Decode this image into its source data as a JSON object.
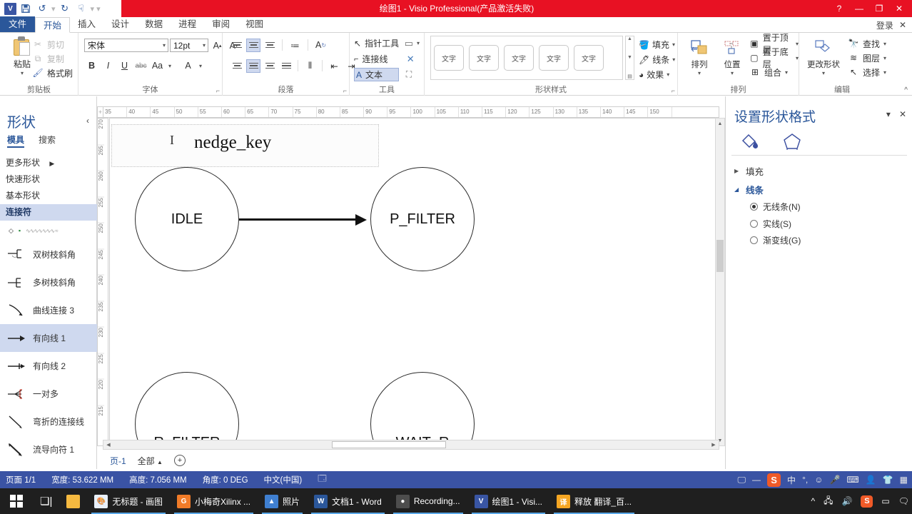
{
  "window": {
    "title": "绘图1 -  Visio Professional(产品激活失败)",
    "logo": "V",
    "quick_access": [
      "save-icon",
      "undo-icon",
      "redo-icon",
      "pointer-icon",
      "more-icon"
    ],
    "help_label": "?",
    "minimize_label": "—",
    "restore_label": "❐",
    "close_label": "✕",
    "signin_label": "登录",
    "signin_close": "✕"
  },
  "ribbon": {
    "file_tab": "文件",
    "tabs": [
      {
        "label": "开始",
        "active": true
      },
      {
        "label": "插入",
        "active": false
      },
      {
        "label": "设计",
        "active": false
      },
      {
        "label": "数据",
        "active": false
      },
      {
        "label": "进程",
        "active": false
      },
      {
        "label": "审阅",
        "active": false
      },
      {
        "label": "视图",
        "active": false
      }
    ],
    "groups": {
      "clipboard": {
        "label": "剪贴板",
        "paste_label": "粘贴",
        "cut_label": "剪切",
        "copy_label": "复制",
        "format_painter_label": "格式刷"
      },
      "font": {
        "label": "字体",
        "font_name": "宋体",
        "font_size": "12pt",
        "grow_label": "A",
        "shrink_label": "A",
        "bold_label": "B",
        "italic_label": "I",
        "underline_label": "U",
        "strike_label": "abc",
        "case_label": "Aa",
        "color_label": "A"
      },
      "paragraph": {
        "label": "段落",
        "bullets_label": "≔",
        "text_dir_label": "A"
      },
      "tools": {
        "label": "工具",
        "pointer_label": "指针工具",
        "connector_label": "连接线",
        "text_label": "文本"
      },
      "shape_styles": {
        "label": "形状样式",
        "thumbnails": [
          "文字",
          "文字",
          "文字",
          "文字",
          "文字"
        ],
        "fill_label": "填充",
        "line_label": "线条",
        "effects_label": "效果"
      },
      "arrange": {
        "label": "排列",
        "arrange_label": "排列",
        "position_label": "位置",
        "bring_front_label": "置于顶层",
        "send_back_label": "置于底层",
        "group_label": "组合"
      },
      "editing": {
        "label": "编辑",
        "change_shape_label": "更改形状",
        "find_label": "查找",
        "layers_label": "图层",
        "select_label": "选择"
      }
    }
  },
  "shapes_panel": {
    "title": "形状",
    "collapse_label": "‹",
    "tabs": [
      {
        "label": "模具",
        "active": true
      },
      {
        "label": "搜索",
        "active": false
      }
    ],
    "categories": [
      {
        "label": "更多形状",
        "active": false,
        "has_arrow": true
      },
      {
        "label": "快速形状",
        "active": false,
        "has_arrow": false
      },
      {
        "label": "基本形状",
        "active": false,
        "has_arrow": false
      },
      {
        "label": "连接符",
        "active": true,
        "has_arrow": false
      }
    ],
    "shapes": [
      {
        "label": "双树枝斜角",
        "active": false
      },
      {
        "label": "多树枝斜角",
        "active": false
      },
      {
        "label": "曲线连接 3",
        "active": false
      },
      {
        "label": "有向线 1",
        "active": true
      },
      {
        "label": "有向线 2",
        "active": false
      },
      {
        "label": "一对多",
        "active": false
      },
      {
        "label": "弯折的连接线",
        "active": false
      },
      {
        "label": "流导向符 1",
        "active": false
      }
    ]
  },
  "canvas": {
    "ruler_h_ticks": [
      "35",
      "40",
      "45",
      "50",
      "55",
      "60",
      "65",
      "70",
      "75",
      "80",
      "85",
      "90",
      "95",
      "100",
      "105",
      "110",
      "115",
      "120",
      "125",
      "130",
      "135",
      "140",
      "145",
      "150"
    ],
    "ruler_v_ticks": [
      "270",
      "265",
      "260",
      "255",
      "250",
      "245",
      "240",
      "235",
      "230",
      "225",
      "220",
      "215"
    ],
    "textbox_value": "nedge_key",
    "nodes": [
      {
        "label": "IDLE"
      },
      {
        "label": "P_FILTER"
      },
      {
        "label": "R_FILTER"
      },
      {
        "label": "WAIT_R"
      }
    ],
    "page_tab": "页-1",
    "all_pages_label": "全部",
    "add_page_label": "+"
  },
  "format_panel": {
    "title": "设置形状格式",
    "collapse_label": "▾",
    "close_label": "✕",
    "icons": [
      "fill-bucket-icon",
      "pentagon-shape-icon"
    ],
    "sections": [
      {
        "label": "填充",
        "expanded": false
      },
      {
        "label": "线条",
        "expanded": true
      }
    ],
    "line_options": [
      {
        "label": "无线条(N)",
        "selected": true
      },
      {
        "label": "实线(S)",
        "selected": false
      },
      {
        "label": "渐变线(G)",
        "selected": false
      }
    ]
  },
  "statusbar": {
    "page_label": "页面 1/1",
    "width_label": "宽度: 53.622 MM",
    "height_label": "高度: 7.056 MM",
    "angle_label": "角度: 0 DEG",
    "language_label": "中文(中国)",
    "access_icon": "accessibility-icon"
  },
  "ime": {
    "mode_label": "中",
    "punct_label": "°,",
    "emoji_label": "☺",
    "mic_label": "🎤",
    "keyboard_label": "⌨",
    "user_label": "👤",
    "skin_label": "👕",
    "apps_label": "▦",
    "brand_label": "S"
  },
  "taskbar": {
    "start_label": "start-icon",
    "taskview_label": "task-view-icon",
    "items": [
      {
        "label": "",
        "icon": "folder-icon",
        "icon_color": "#f5b940",
        "icon_text": "📁",
        "running": false
      },
      {
        "label": "无标题 - 画图",
        "icon": "paint-icon",
        "icon_color": "#eef3fb",
        "icon_text": "🎨",
        "running": true
      },
      {
        "label": "小梅奇Xilinx ...",
        "icon": "app-icon",
        "icon_color": "#f07b28",
        "icon_text": "G",
        "running": true
      },
      {
        "label": "照片",
        "icon": "photos-icon",
        "icon_color": "#3f7fd0",
        "icon_text": "🖼",
        "running": true
      },
      {
        "label": "文档1 - Word",
        "icon": "word-icon",
        "icon_color": "#2b579a",
        "icon_text": "W",
        "running": true
      },
      {
        "label": "Recording...",
        "icon": "recorder-icon",
        "icon_color": "#4d4d4d",
        "icon_text": "●",
        "running": true
      },
      {
        "label": "绘图1 - Visi...",
        "icon": "visio-icon",
        "icon_color": "#3955a3",
        "icon_text": "V",
        "running": true
      },
      {
        "label": "释放 翻译_百...",
        "icon": "translate-icon",
        "icon_color": "#f5a623",
        "icon_text": "译",
        "running": true
      }
    ],
    "tray": [
      "^",
      "network-icon",
      "volume-icon",
      "sogou-icon",
      "battery-icon",
      "notification-icon"
    ]
  },
  "colors": {
    "accent": "#2b579a",
    "title_red": "#e81123",
    "status_blue": "#3a53a4",
    "select_blue": "#cfd9ef"
  }
}
